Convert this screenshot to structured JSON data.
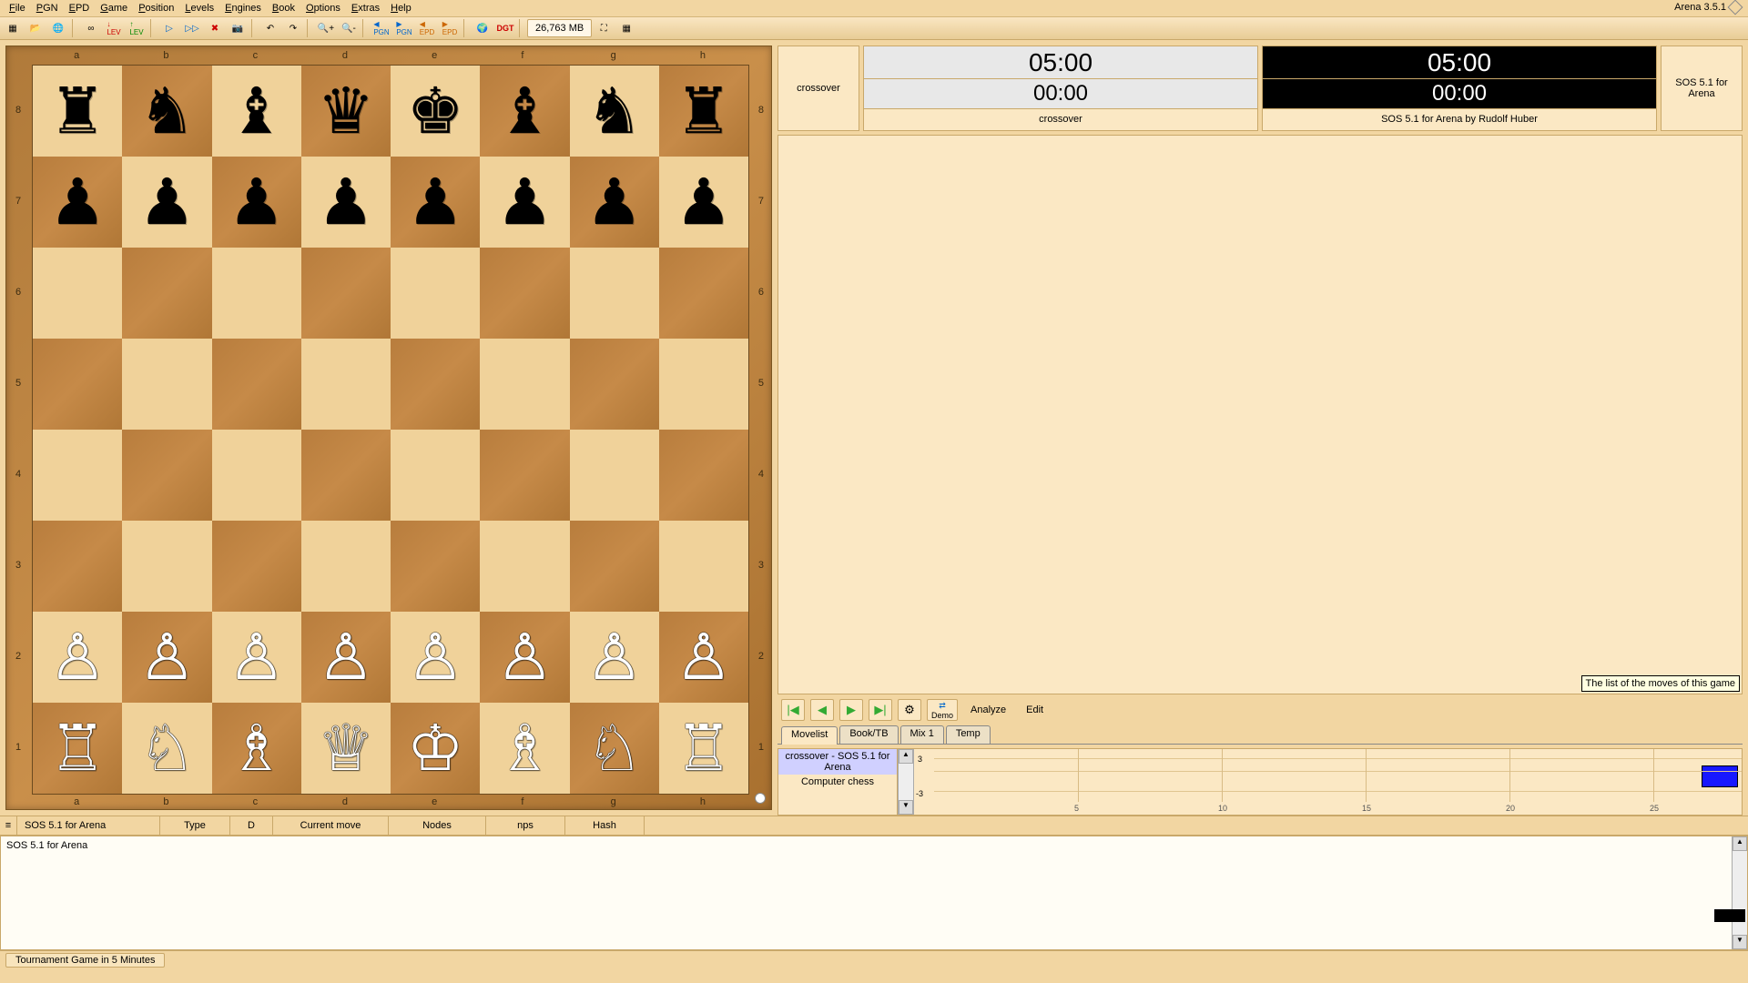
{
  "app": {
    "title": "Arena 3.5.1"
  },
  "menu": [
    "File",
    "PGN",
    "EPD",
    "Game",
    "Position",
    "Levels",
    "Engines",
    "Book",
    "Options",
    "Extras",
    "Help"
  ],
  "toolbar": {
    "memory": "26,763 MB",
    "buttons": [
      "board",
      "open",
      "web",
      "inf",
      "lev-minus",
      "lev-plus",
      "play",
      "ff",
      "stop",
      "cam",
      "undo",
      "redo",
      "zoom-in",
      "zoom-out",
      "pgn-l",
      "pgn-r",
      "epd-l",
      "epd-r",
      "globe",
      "dgt"
    ]
  },
  "board": {
    "files": [
      "a",
      "b",
      "c",
      "d",
      "e",
      "f",
      "g",
      "h"
    ],
    "ranks": [
      "8",
      "7",
      "6",
      "5",
      "4",
      "3",
      "2",
      "1"
    ],
    "position": [
      [
        "r",
        "n",
        "b",
        "q",
        "k",
        "b",
        "n",
        "r"
      ],
      [
        "p",
        "p",
        "p",
        "p",
        "p",
        "p",
        "p",
        "p"
      ],
      [
        "",
        "",
        "",
        "",
        "",
        "",
        "",
        ""
      ],
      [
        "",
        "",
        "",
        "",
        "",
        "",
        "",
        ""
      ],
      [
        "",
        "",
        "",
        "",
        "",
        "",
        "",
        ""
      ],
      [
        "",
        "",
        "",
        "",
        "",
        "",
        "",
        ""
      ],
      [
        "P",
        "P",
        "P",
        "P",
        "P",
        "P",
        "P",
        "P"
      ],
      [
        "R",
        "N",
        "B",
        "Q",
        "K",
        "B",
        "N",
        "R"
      ]
    ],
    "side_to_move": "white"
  },
  "clocks": {
    "left_name": "crossover",
    "right_name": "SOS 5.1 for Arena",
    "white": {
      "main": "05:00",
      "sub": "00:00",
      "label": "crossover"
    },
    "black": {
      "main": "05:00",
      "sub": "00:00",
      "label": "SOS 5.1 for Arena by Rudolf Huber"
    }
  },
  "move_list": {
    "tooltip": "The list of the moves of this game"
  },
  "controls": {
    "demo": "Demo",
    "analyze": "Analyze",
    "edit": "Edit"
  },
  "tabs": [
    "Movelist",
    "Book/TB",
    "Mix 1",
    "Temp"
  ],
  "active_tab": 0,
  "eval": {
    "entries": [
      "crossover - SOS 5.1 for Arena",
      "Computer chess"
    ],
    "y_ticks": [
      "3",
      "-3"
    ],
    "x_ticks": [
      "5",
      "10",
      "15",
      "20",
      "25"
    ]
  },
  "status_cols": {
    "engine": "SOS 5.1 for Arena",
    "type": "Type",
    "d": "D",
    "current_move": "Current move",
    "nodes": "Nodes",
    "nps": "nps",
    "hash": "Hash"
  },
  "engine_output": "SOS 5.1 for Arena",
  "footer": {
    "status": "Tournament Game in 5 Minutes"
  }
}
